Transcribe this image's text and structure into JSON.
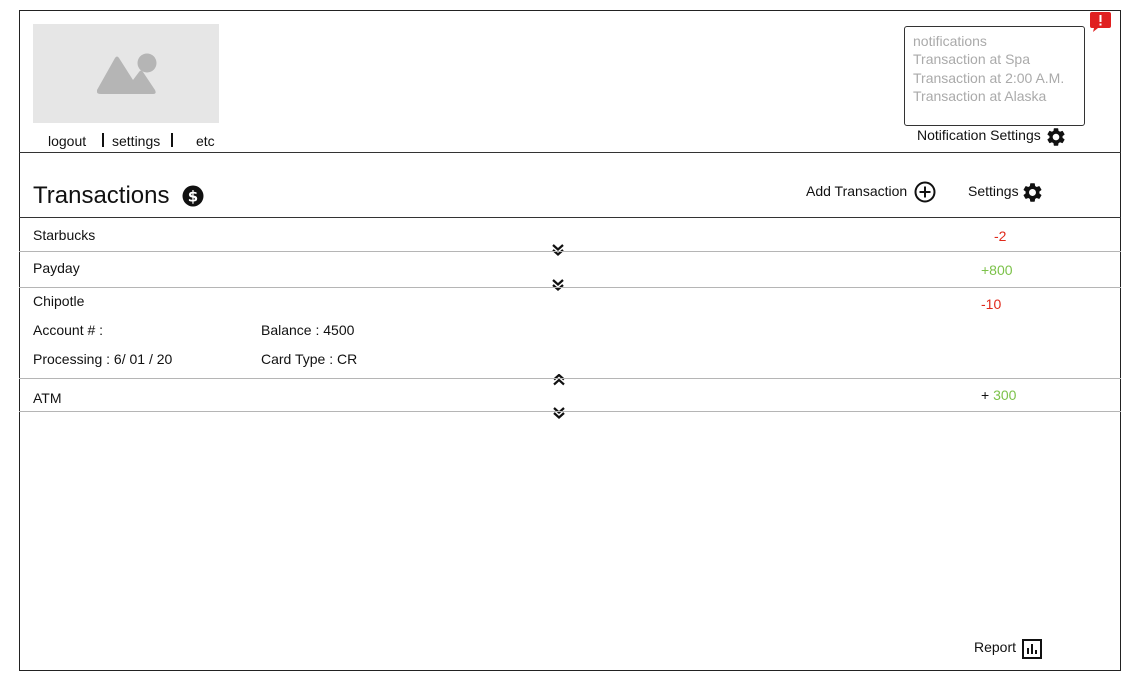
{
  "nav": {
    "logout": "logout",
    "settings": "settings",
    "etc": "etc"
  },
  "notifications": {
    "header": "notifications",
    "items": [
      "Transaction at Spa",
      "Transaction at 2:00 A.M.",
      "Transaction at Alaska"
    ],
    "settings_label": "Notification Settings"
  },
  "page": {
    "title": "Transactions",
    "add_label": "Add Transaction",
    "settings_label": "Settings",
    "report_label": "Report"
  },
  "transactions": [
    {
      "name": "Starbucks",
      "amount": "-2"
    },
    {
      "name": "Payday",
      "amount": "+800"
    },
    {
      "name": "Chipotle",
      "amount": "-10",
      "details": {
        "account": "Account # :",
        "balance": "Balance : 4500",
        "processing": "Processing : 6/ 01 / 20",
        "card_type": "Card Type : CR"
      }
    },
    {
      "name": "ATM",
      "amount_sign": "+",
      "amount": "300"
    }
  ],
  "colors": {
    "negative": "#e0291b",
    "positive": "#7cc24a",
    "alert": "#e02020"
  },
  "icons": [
    "image-placeholder-icon",
    "alert-icon",
    "gear-icon",
    "dollar-icon",
    "add-circle-icon",
    "chevron-double-down-icon",
    "chevron-double-up-icon",
    "bar-chart-icon"
  ]
}
